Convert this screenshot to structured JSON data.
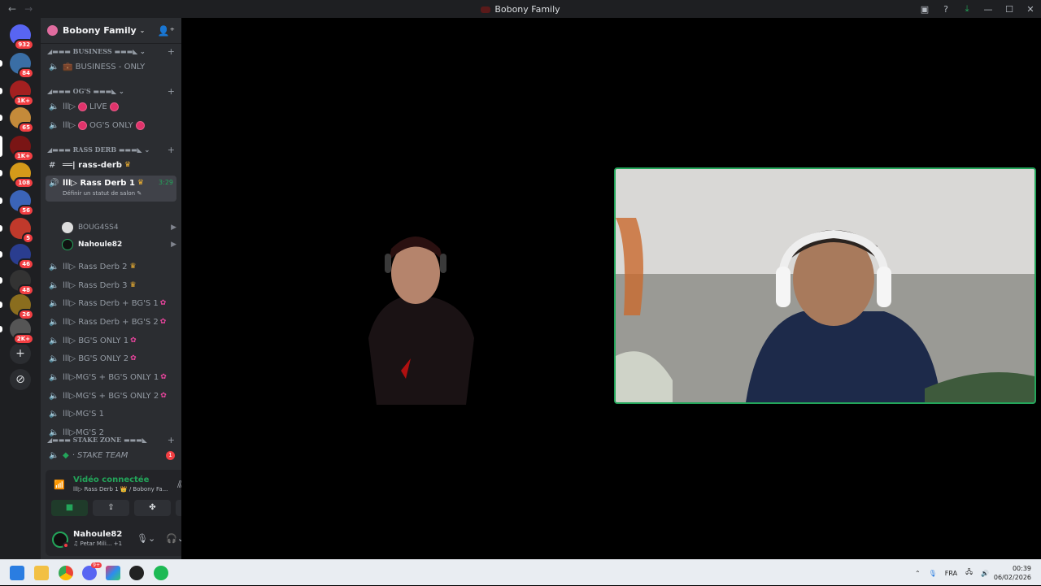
{
  "window": {
    "title": "Bobony Family",
    "back": "←",
    "forward": "→",
    "controls": {
      "minimize": "—",
      "maximize": "☐",
      "close": "✕"
    }
  },
  "servers": [
    {
      "name": "discord-home",
      "badge": "932",
      "color": "#5865f2"
    },
    {
      "name": "server-1",
      "badge": "84",
      "color": "#3a6ea5"
    },
    {
      "name": "server-2",
      "badge": "1K+",
      "color": "#a32020"
    },
    {
      "name": "server-3",
      "badge": "65",
      "color": "#c48a3a"
    },
    {
      "name": "server-4",
      "badge": "1K+",
      "color": "#7a1515"
    },
    {
      "name": "server-5",
      "badge": "108",
      "color": "#d49a1a"
    },
    {
      "name": "server-6",
      "badge": "56",
      "color": "#3b64b8"
    },
    {
      "name": "server-7",
      "badge": "5",
      "color": "#c0392b"
    },
    {
      "name": "server-8",
      "badge": "46",
      "color": "#2a3d8f"
    },
    {
      "name": "server-9",
      "badge": "48",
      "color": "#333333"
    },
    {
      "name": "server-10",
      "badge": "26",
      "color": "#8a6d1e"
    },
    {
      "name": "server-11",
      "badge": "2K+",
      "color": "#555555"
    }
  ],
  "guild": {
    "name": "Bobony Family",
    "chevron": "⌄"
  },
  "categories": [
    {
      "label": "◢▬▬▬ BUSINESS ▬▬▬◣  ⌄",
      "plus": "+"
    },
    {
      "label": "◢▬▬▬ OG'S ▬▬▬◣  ⌄",
      "plus": "+"
    },
    {
      "label": "◢▬▬▬ RASS DERB ▬▬▬◣  ⌄",
      "plus": "+"
    },
    {
      "label": "◢▬▬▬ STAKE ZONE ▬▬▬◣",
      "plus": "+"
    }
  ],
  "channels": {
    "business_only": "💼 BUSINESS - ONLY",
    "live_prefix": "lll▷",
    "live": "LIVE",
    "ogs_prefix": "lll▷",
    "ogs": "OG'S ONLY",
    "rass_derb_text": "══| rass-derb",
    "rass_derb_1": "lll▷ Rass Derb 1",
    "rass_derb_1_timer": "3:29",
    "rass_derb_1_status": "Définir un statut de salon ✎",
    "members": [
      "BOUG4SS4",
      "Nahoule82"
    ],
    "rass_derb_2": "lll▷ Rass Derb 2",
    "rass_derb_3": "lll▷ Rass Derb 3",
    "rass_derb_bg1": "lll▷ Rass Derb + BG'S 1",
    "rass_derb_bg2": "lll▷ Rass Derb + BG'S 2",
    "bg_only_1": "lll▷ BG'S ONLY 1",
    "bg_only_2": "lll▷ BG'S ONLY 2",
    "mg_bg_1": "lll▷MG'S + BG'S ONLY 1",
    "mg_bg_2": "lll▷MG'S + BG'S ONLY 2",
    "mg_1": "lll▷MG'S 1",
    "mg_2": "lll▷MG'S 2",
    "stake_team": "· STAKE TEAM",
    "stake_badge": "1"
  },
  "voice": {
    "status": "Vidéo connectée",
    "channel": "lll▷ Rass Derb 1 👑 / Bobony Fa...",
    "buttons": [
      "■",
      "⇪",
      "✤",
      "✺"
    ]
  },
  "user": {
    "name": "Nahoule82",
    "status": "♫ Petar Mili...",
    "extra": "+1"
  },
  "taskbar": {
    "lang": "FRA",
    "time": "00:39",
    "date": "06/02/2026",
    "discord_badge": "9+"
  },
  "colors": {
    "accent_green": "#23a55a",
    "notification_red": "#f23f43",
    "sidebar": "#2b2d31",
    "server_rail": "#1e1f22"
  }
}
